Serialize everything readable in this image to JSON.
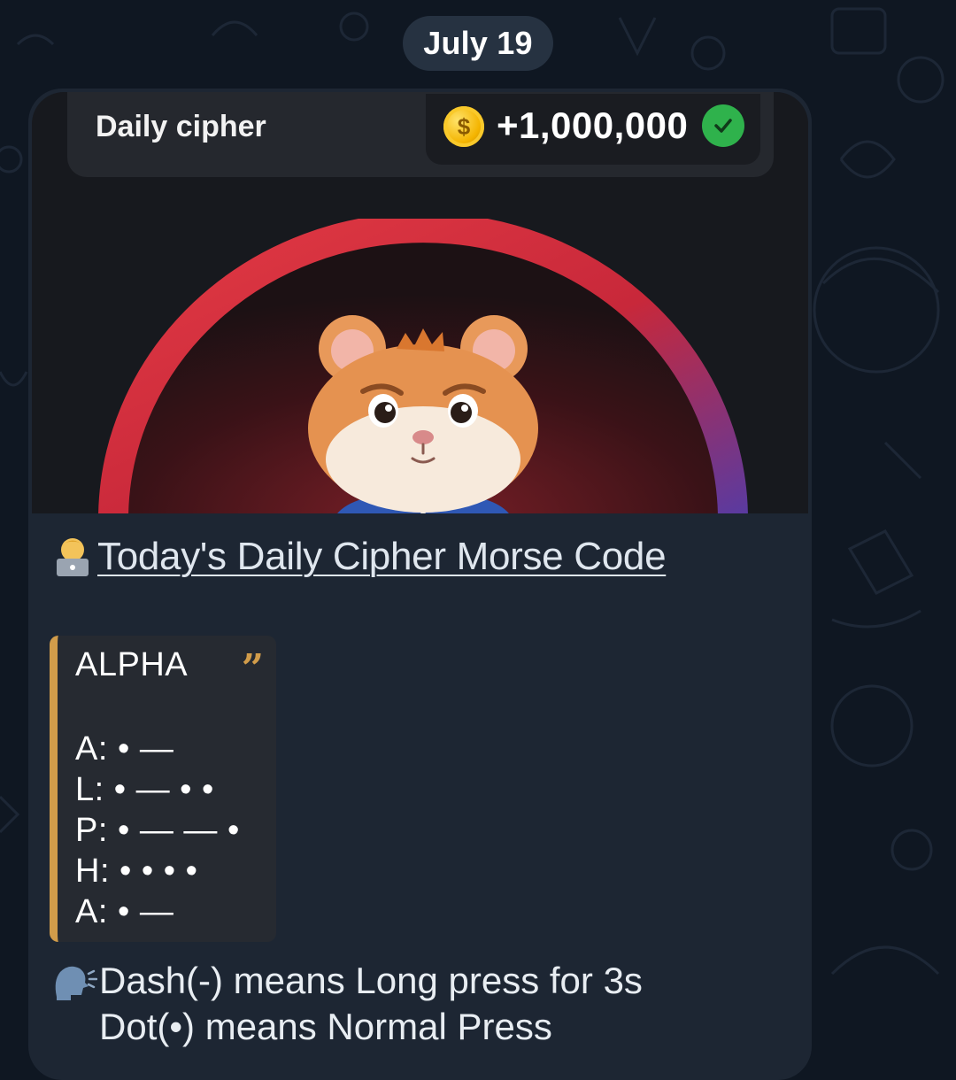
{
  "chat": {
    "date_label": "July 19"
  },
  "game_card": {
    "header_title": "Daily cipher",
    "reward_amount": "+1,000,000",
    "coin_symbol": "$",
    "reward_status": "claimed",
    "character": "hamster"
  },
  "post": {
    "link_title": "Today's Daily Cipher Morse Code",
    "quote": {
      "title": "ALPHA",
      "lines": [
        "A: • —",
        "L: • — • •",
        "P: • — — •",
        "H: • • • •",
        "A: • —"
      ]
    },
    "instructions": [
      "Dash(-) means Long press for 3s",
      "Dot(•) means Normal Press"
    ]
  },
  "colors": {
    "background": "#0f1722",
    "bubble": "#1d2633",
    "accent_quote": "#d19c4a",
    "check_green": "#2fb24c",
    "coin_gold": "#f4b400",
    "arc_red": "#d8303c"
  }
}
